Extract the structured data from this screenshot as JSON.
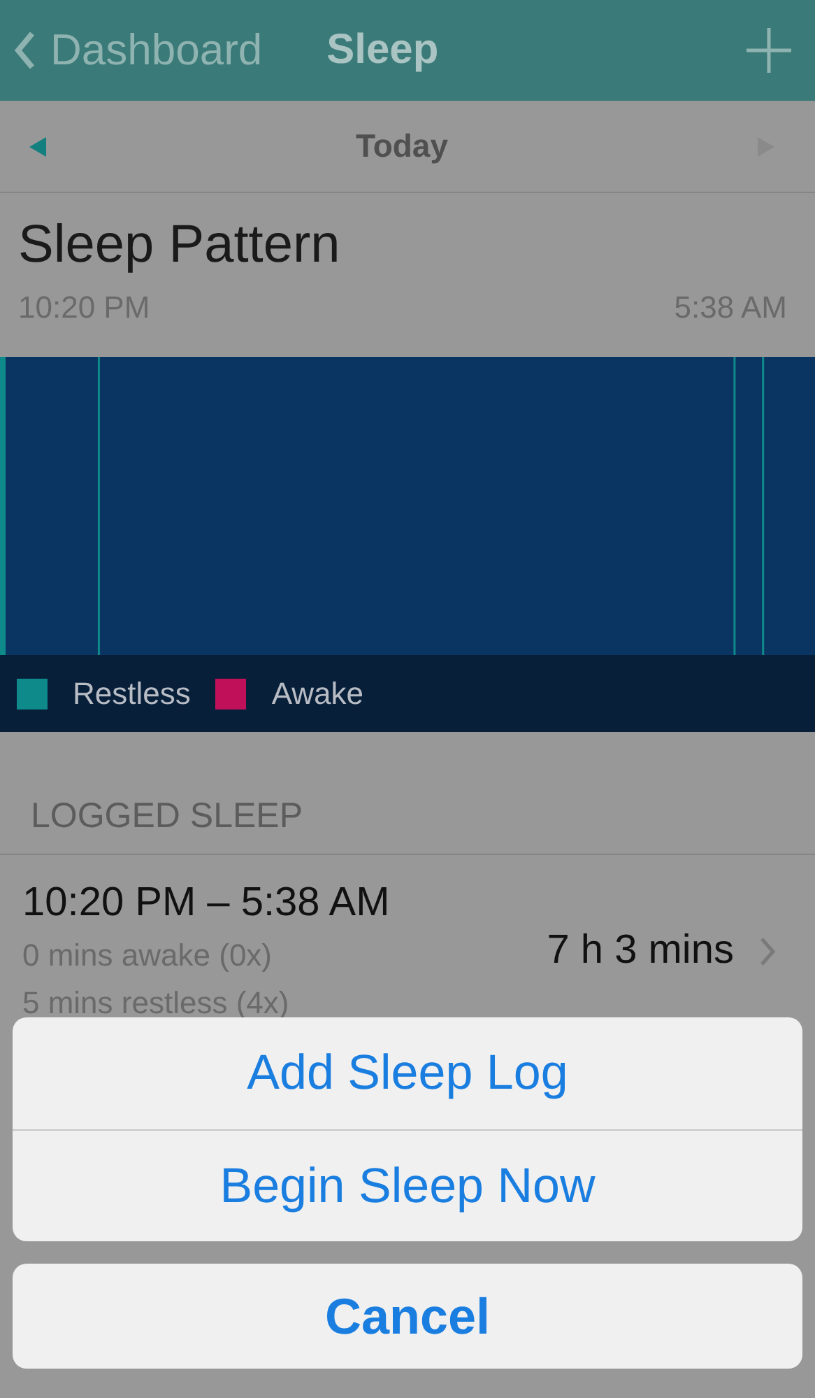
{
  "nav_bar": {
    "back_label": "Dashboard",
    "title": "Sleep"
  },
  "date_bar": {
    "label": "Today",
    "prev_enabled": true,
    "next_enabled": false
  },
  "sleep_pattern": {
    "title": "Sleep Pattern",
    "start_time": "10:20 PM",
    "end_time": "5:38 AM",
    "legend": [
      {
        "label": "Restless",
        "color": "#0f8a8a"
      },
      {
        "label": "Awake",
        "color": "#c0105a"
      }
    ]
  },
  "logged_sleep": {
    "heading": "LOGGED SLEEP",
    "entries": [
      {
        "time_range": "10:20 PM – 5:38 AM",
        "awake": "0 mins awake (0x)",
        "restless": "5 mins restless (4x)",
        "duration": "7 h 3 mins"
      }
    ]
  },
  "action_sheet": {
    "actions": [
      "Add Sleep Log",
      "Begin Sleep Now"
    ],
    "cancel": "Cancel"
  }
}
